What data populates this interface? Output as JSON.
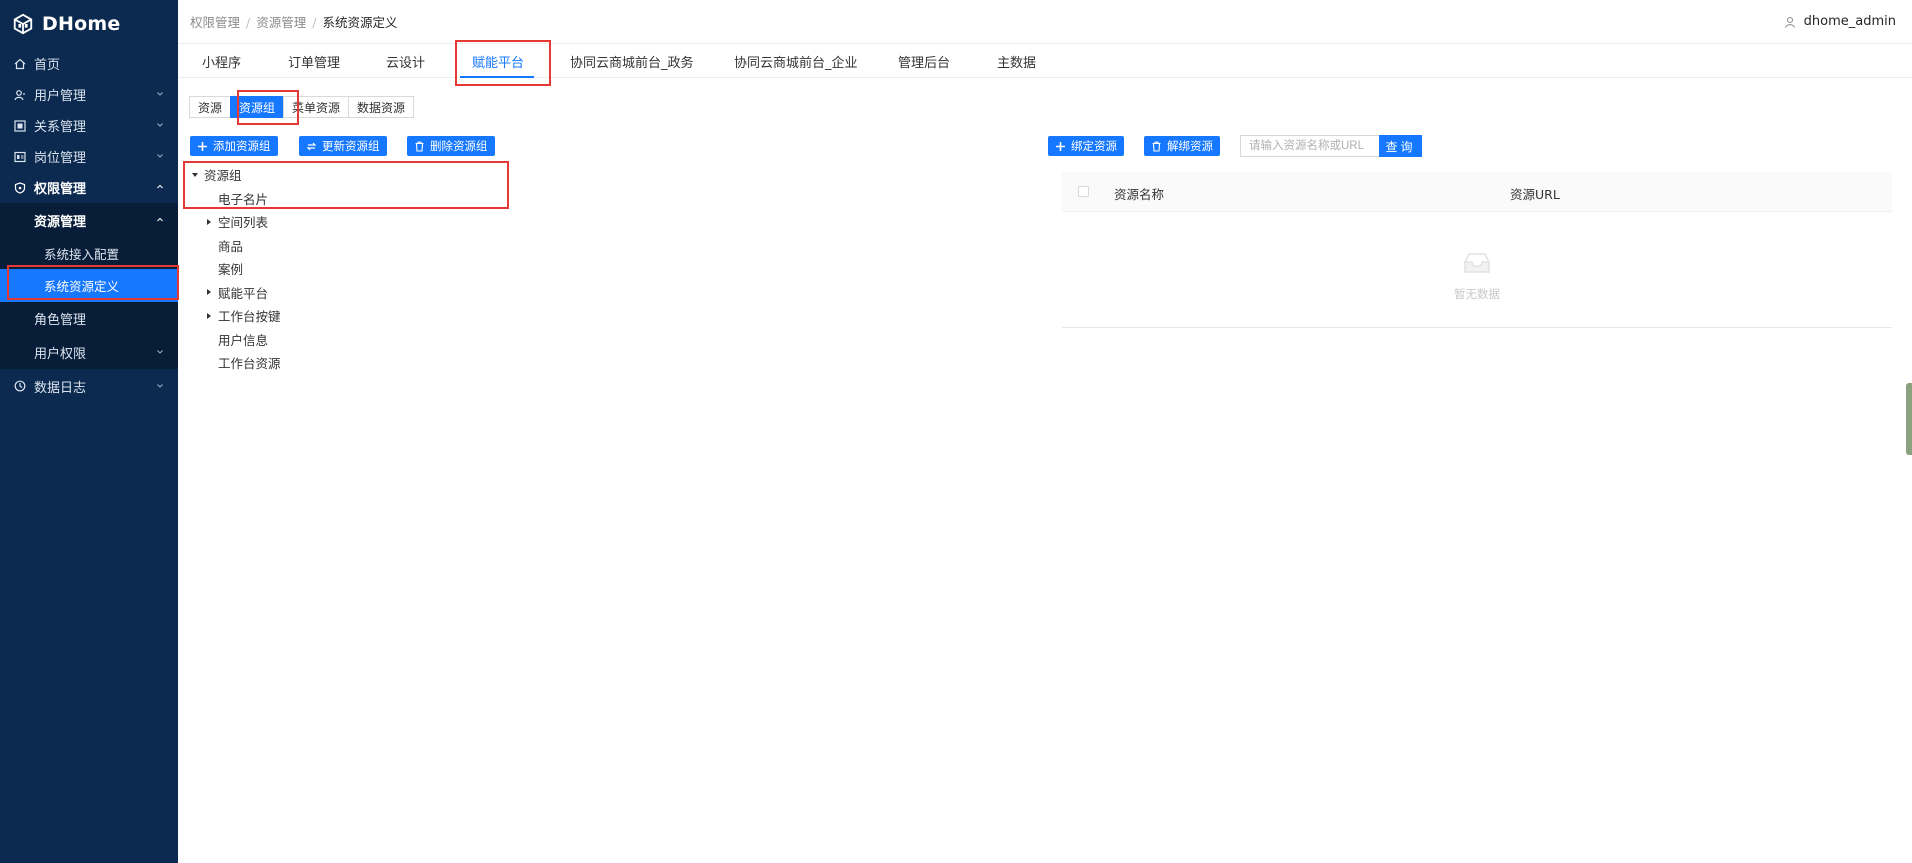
{
  "app": {
    "name": "DHome"
  },
  "sidebar": {
    "items": [
      {
        "label": "首页",
        "icon": "home-icon"
      },
      {
        "label": "用户管理",
        "icon": "user-icon"
      },
      {
        "label": "关系管理",
        "icon": "relation-icon"
      },
      {
        "label": "岗位管理",
        "icon": "post-icon"
      },
      {
        "label": "权限管理",
        "icon": "shield-icon"
      }
    ],
    "permission_sub": [
      {
        "label": "资源管理"
      },
      {
        "label": "系统接入配置"
      },
      {
        "label": "系统资源定义"
      },
      {
        "label": "角色管理"
      },
      {
        "label": "用户权限"
      }
    ],
    "last_item": {
      "label": "数据日志",
      "icon": "log-icon"
    }
  },
  "header": {
    "breadcrumb": [
      "权限管理",
      "资源管理",
      "系统资源定义"
    ],
    "breadcrumb_sep": "/",
    "user": "dhome_admin"
  },
  "tabs": [
    {
      "label": "小程序"
    },
    {
      "label": "订单管理"
    },
    {
      "label": "云设计"
    },
    {
      "label": "赋能平台"
    },
    {
      "label": "协同云商城前台_政务"
    },
    {
      "label": "协同云商城前台_企业"
    },
    {
      "label": "管理后台"
    },
    {
      "label": "主数据"
    }
  ],
  "subtabs": [
    {
      "label": "资源"
    },
    {
      "label": "资源组"
    },
    {
      "label": "菜单资源"
    },
    {
      "label": "数据资源"
    }
  ],
  "toolbar": {
    "add_group": "添加资源组",
    "update_group": "更新资源组",
    "delete_group": "删除资源组",
    "bind": "绑定资源",
    "unbind": "解绑资源"
  },
  "tree": {
    "root": "资源组",
    "children": [
      {
        "label": "电子名片",
        "expandable": false
      },
      {
        "label": "空间列表",
        "expandable": true
      },
      {
        "label": "商品",
        "expandable": false
      },
      {
        "label": "案例",
        "expandable": false
      },
      {
        "label": "赋能平台",
        "expandable": true
      },
      {
        "label": "工作台按键",
        "expandable": true
      },
      {
        "label": "用户信息",
        "expandable": false
      },
      {
        "label": "工作台资源",
        "expandable": false
      }
    ]
  },
  "search": {
    "placeholder": "请输入资源名称或URL",
    "button": "查询"
  },
  "table": {
    "columns": [
      "资源名称",
      "资源URL"
    ],
    "empty_text": "暂无数据"
  },
  "colors": {
    "sidebar_bg": "#0c2a4f",
    "accent": "#1677ff",
    "highlight": "#e53935"
  }
}
